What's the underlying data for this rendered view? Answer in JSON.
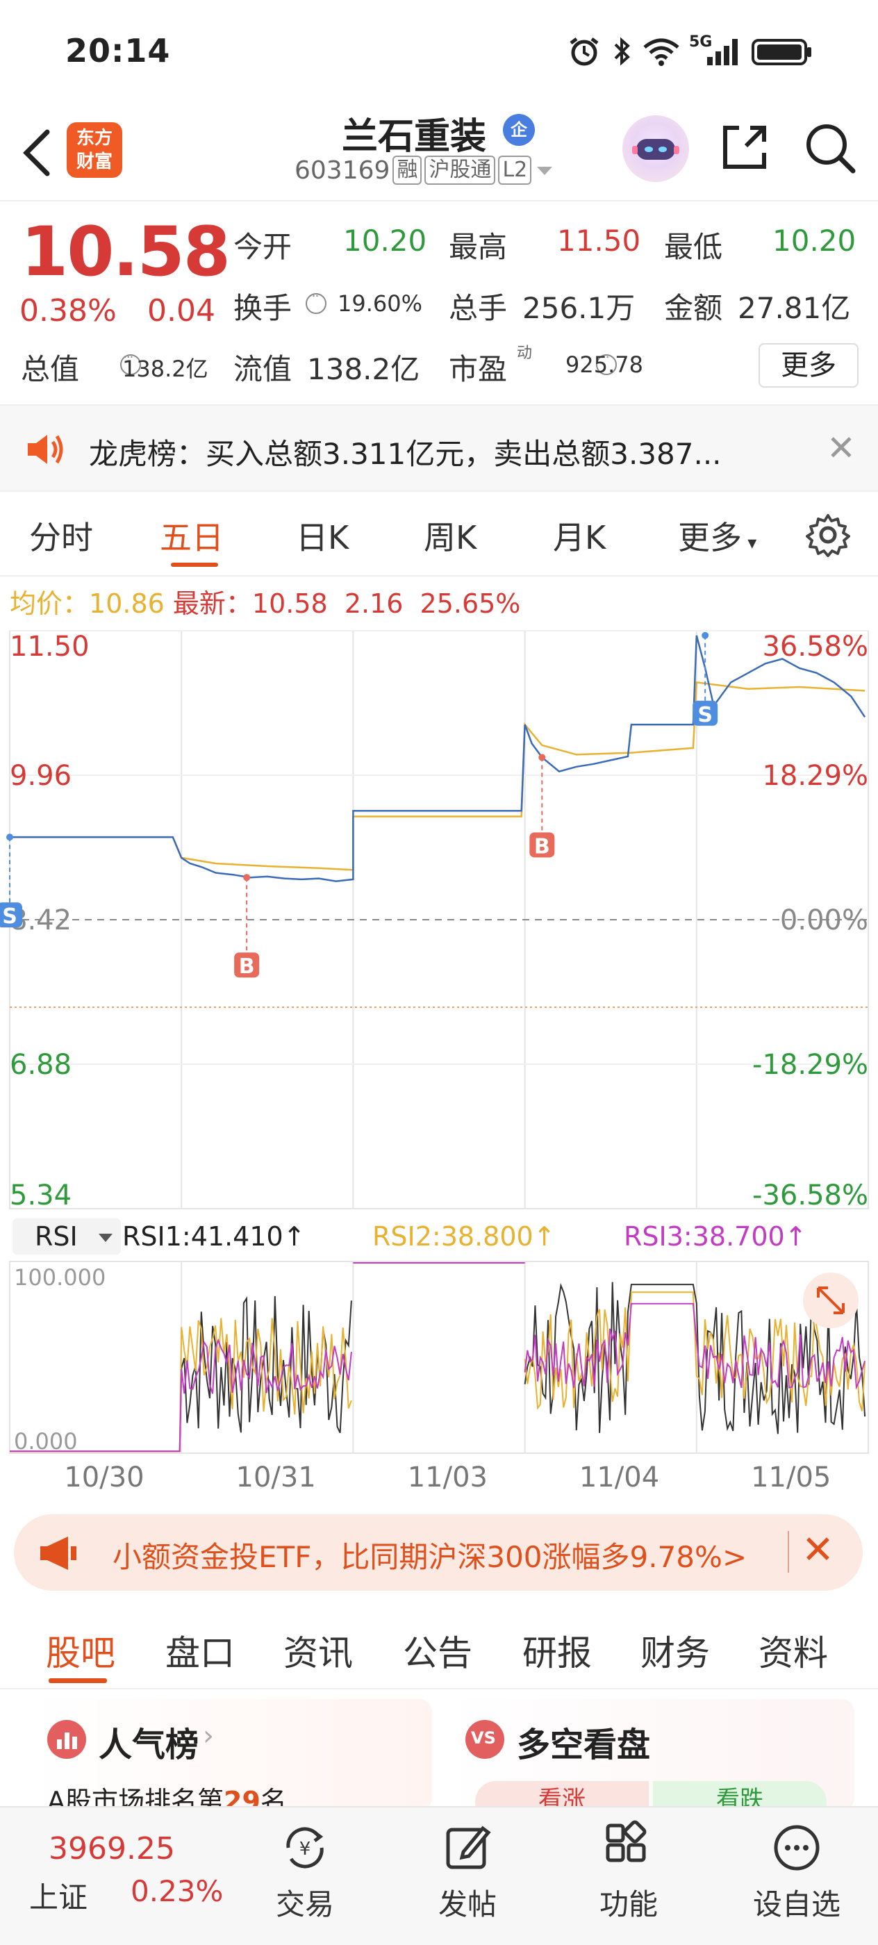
{
  "status_bar": {
    "time": "20:14",
    "network": "5G"
  },
  "header": {
    "logo_text_line1": "东方",
    "logo_text_line2": "财富",
    "stock_name": "兰石重装",
    "stock_badge": "企",
    "stock_code": "603169",
    "tags": [
      "融",
      "沪股通",
      "L2"
    ]
  },
  "quote": {
    "price": "10.58",
    "change_pct": "0.38%",
    "change": "0.04",
    "open_label": "今开",
    "open": "10.20",
    "high_label": "最高",
    "high": "11.50",
    "low_label": "最低",
    "low": "10.20",
    "turnover_label": "换手",
    "turnover": "19.60%",
    "volume_label": "总手",
    "volume": "256.1万",
    "amount_label": "金额",
    "amount": "27.81亿",
    "mktcap_label": "总值",
    "mktcap": "138.2亿",
    "float_label": "流值",
    "float": "138.2亿",
    "pe_label": "市盈",
    "pe_sup": "动",
    "pe": "925.78",
    "more": "更多"
  },
  "banner": {
    "text": "龙虎榜：买入总额3.311亿元，卖出总额3.387..."
  },
  "tabs": [
    "分时",
    "五日",
    "日K",
    "周K",
    "月K",
    "更多"
  ],
  "active_tab": "五日",
  "chart_info": {
    "avg_label": "均价：",
    "avg": "10.86",
    "latest_label": "最新：",
    "latest": "10.58",
    "latest_chg": "2.16",
    "latest_pct": "25.65%",
    "rsi_selector": "RSI",
    "rsi1": "RSI1:41.410↑",
    "rsi2": "RSI2:38.800↑",
    "rsi3": "RSI3:38.700↑"
  },
  "chart_data": {
    "type": "line",
    "left_axis": [
      "11.50",
      "9.96",
      "8.42",
      "6.88",
      "5.34"
    ],
    "right_axis": [
      "36.58%",
      "18.29%",
      "0.00%",
      "-18.29%",
      "-36.58%"
    ],
    "x_labels": [
      "10/30",
      "10/31",
      "11/03",
      "11/04",
      "11/05"
    ],
    "ylim": [
      5.34,
      11.5
    ],
    "reference": 8.42,
    "series": [
      {
        "values": [
          [
            0.0,
            9.3
          ],
          [
            0.95,
            9.3
          ],
          [
            1.0,
            9.08
          ],
          [
            1.05,
            9.02
          ],
          [
            1.12,
            8.98
          ],
          [
            1.2,
            8.92
          ],
          [
            1.3,
            8.9
          ],
          [
            1.4,
            8.87
          ],
          [
            1.5,
            8.88
          ],
          [
            1.6,
            8.86
          ],
          [
            1.7,
            8.85
          ],
          [
            1.8,
            8.86
          ],
          [
            1.9,
            8.83
          ],
          [
            2.0,
            8.85
          ],
          [
            2.0,
            9.58
          ],
          [
            2.98,
            9.58
          ],
          [
            3.0,
            10.5
          ],
          [
            3.04,
            10.3
          ],
          [
            3.1,
            10.15
          ],
          [
            3.2,
            10.0
          ],
          [
            3.3,
            10.05
          ],
          [
            3.4,
            10.08
          ],
          [
            3.5,
            10.12
          ],
          [
            3.6,
            10.16
          ],
          [
            3.62,
            10.5
          ],
          [
            3.98,
            10.5
          ],
          [
            4.0,
            11.45
          ],
          [
            4.05,
            11.1
          ],
          [
            4.1,
            10.7
          ],
          [
            4.2,
            10.95
          ],
          [
            4.3,
            11.05
          ],
          [
            4.4,
            11.15
          ],
          [
            4.5,
            11.2
          ],
          [
            4.6,
            11.1
          ],
          [
            4.7,
            11.05
          ],
          [
            4.8,
            10.95
          ],
          [
            4.9,
            10.8
          ],
          [
            4.98,
            10.58
          ]
        ]
      },
      {
        "values": [
          [
            0.0,
            9.3
          ],
          [
            0.95,
            9.3
          ],
          [
            1.0,
            9.08
          ],
          [
            1.2,
            9.02
          ],
          [
            1.5,
            8.99
          ],
          [
            1.8,
            8.97
          ],
          [
            2.0,
            8.95
          ],
          [
            2.0,
            9.52
          ],
          [
            2.98,
            9.52
          ],
          [
            3.0,
            10.5
          ],
          [
            3.1,
            10.28
          ],
          [
            3.3,
            10.18
          ],
          [
            3.62,
            10.2
          ],
          [
            3.98,
            10.25
          ],
          [
            4.0,
            10.95
          ],
          [
            4.3,
            10.88
          ],
          [
            4.6,
            10.9
          ],
          [
            4.98,
            10.86
          ]
        ]
      }
    ],
    "markers": [
      {
        "label": "S",
        "x": 0.0,
        "y": 9.3
      },
      {
        "label": "B",
        "x": 1.38,
        "y": 8.87
      },
      {
        "label": "B",
        "x": 3.1,
        "y": 10.15
      },
      {
        "label": "S",
        "x": 4.05,
        "y": 11.45
      }
    ],
    "rsi": {
      "ylim": [
        0,
        100
      ],
      "labels": [
        "100.000",
        "0.000"
      ]
    }
  },
  "promo": {
    "text": "小额资金投ETF，比同期沪深300涨幅多9.78%>"
  },
  "bottom_tabs": [
    "股吧",
    "盘口",
    "资讯",
    "公告",
    "研报",
    "财务",
    "资料"
  ],
  "active_bottom_tab": "股吧",
  "cards": {
    "card1_title": "人气榜",
    "card1_sub_prefix": "A股市场排名第",
    "card1_rank": "29",
    "card1_sub_suffix": "名",
    "card2_title": "多空看盘",
    "card2_bull": "看涨",
    "card2_bear": "看跌"
  },
  "index": {
    "value": "3969.25",
    "name": "上证",
    "pct": "0.23%"
  },
  "nav": [
    "交易",
    "发帖",
    "功能",
    "设自选"
  ],
  "colors": {
    "accent": "#e0501c",
    "up": "#d63a36",
    "down": "#2f9a3c",
    "price_line": "#3b6bb8",
    "avg_line": "#e8b130"
  }
}
